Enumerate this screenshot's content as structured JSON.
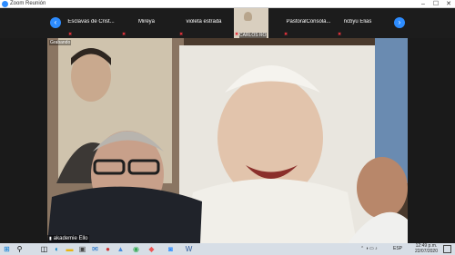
{
  "window": {
    "title": "Zoom Reunión"
  },
  "strip": {
    "participants": [
      {
        "name": "Esclavas de Crist..."
      },
      {
        "name": "Mireya"
      },
      {
        "name": "violeta estrada"
      },
      {
        "name": "CARLOS ROL..."
      },
      {
        "name": "PastoralConsola..."
      },
      {
        "name": "ncbyu Elias"
      }
    ]
  },
  "main": {
    "top_label": "Grabando",
    "speaker_name": "akademie Ello"
  },
  "taskbar": {
    "lang": "ESP",
    "time": "12:49 p.m.",
    "date": "22/07/2020"
  },
  "colors": {
    "zoom_blue": "#2d8cff",
    "muted_red": "#e5323b"
  }
}
